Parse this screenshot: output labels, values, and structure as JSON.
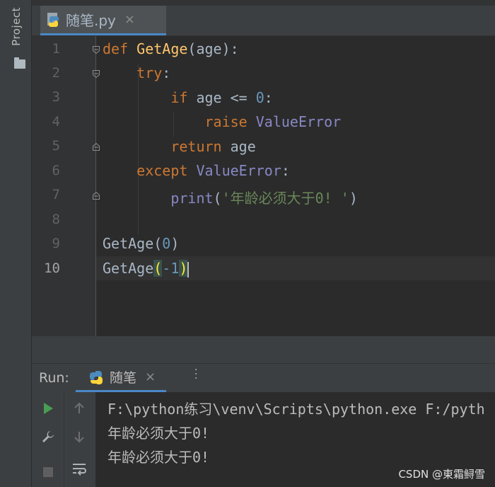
{
  "sidebar": {
    "project_label": "Project"
  },
  "editor_tab": {
    "filename": "随笔.py",
    "close_glyph": "×"
  },
  "line_numbers": [
    "1",
    "2",
    "3",
    "4",
    "5",
    "6",
    "7",
    "8",
    "9",
    "10"
  ],
  "code": {
    "l1": {
      "kw": "def",
      "fn": "GetAge",
      "rest": "(age):"
    },
    "l2": {
      "kw": "try",
      "rest": ":"
    },
    "l3": {
      "kw": "if",
      "mid": " age <= ",
      "num": "0",
      "rest": ":"
    },
    "l4": {
      "kw": "raise",
      "cls": "ValueError"
    },
    "l5": {
      "kw": "return",
      "rest": " age"
    },
    "l6": {
      "kw": "except",
      "cls": "ValueError",
      "rest": ":"
    },
    "l7": {
      "fn": "print",
      "open": "(",
      "str": "'年龄必须大于0! '",
      "close": ")"
    },
    "l9": {
      "name": "GetAge",
      "open": "(",
      "num": "0",
      "close": ")"
    },
    "l10": {
      "name": "GetAge",
      "open": "(",
      "num": "-1",
      "close": ")"
    }
  },
  "run_panel": {
    "label": "Run:",
    "tab_label": "随笔",
    "close_glyph": "×",
    "output": [
      "F:\\python练习\\venv\\Scripts\\python.exe F:/pyth",
      "年龄必须大于0!",
      "年龄必须大于0!"
    ]
  },
  "watermark": "CSDN @東霜鲟雪",
  "colors": {
    "keyword": "#cc7832",
    "function": "#ffc66d",
    "number": "#6897bb",
    "string": "#6a8759",
    "accent": "#4a88c7",
    "run_green": "#499c54"
  }
}
